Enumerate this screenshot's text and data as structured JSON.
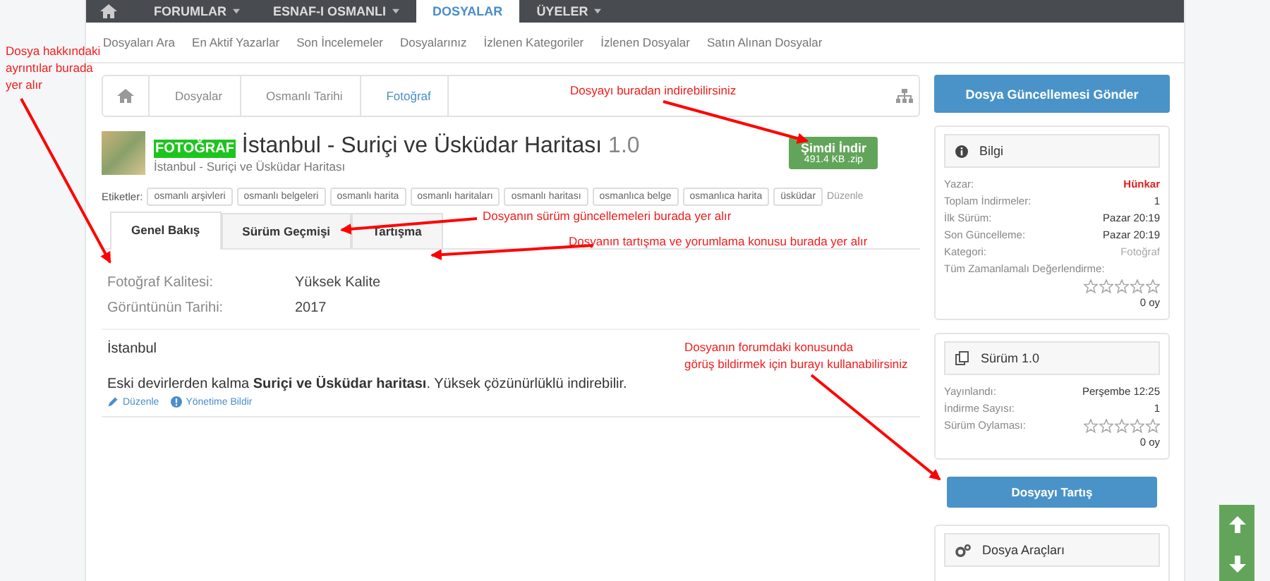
{
  "top_nav": {
    "items": [
      {
        "label": "FORUMLAR",
        "selected": false,
        "has_menu": true
      },
      {
        "label": "ESNAF-I OSMANLI",
        "selected": false,
        "has_menu": true
      },
      {
        "label": "DOSYALAR",
        "selected": true,
        "has_menu": false
      },
      {
        "label": "ÜYELER",
        "selected": false,
        "has_menu": true
      }
    ]
  },
  "sub_nav": {
    "items": [
      "Dosyaları Ara",
      "En Aktif Yazarlar",
      "Son İncelemeler",
      "Dosyalarınız",
      "İzlenen Kategoriler",
      "İzlenen Dosyalar",
      "Satın Alınan Dosyalar"
    ]
  },
  "breadcrumb": [
    {
      "label": "Dosyalar",
      "selected": false
    },
    {
      "label": "Osmanlı Tarihi",
      "selected": false
    },
    {
      "label": "Fotoğraf",
      "selected": true
    }
  ],
  "submit_button": "Dosya Güncellemesi Gönder",
  "resource": {
    "badge": "FOTOĞRAF",
    "title": "İstanbul - Suriçi ve Üsküdar Haritası",
    "version": "1.0",
    "subtitle": "İstanbul - Suriçi ve Üsküdar Haritası",
    "download": {
      "label": "Şimdi İndir",
      "size": "491.4 KB .zip"
    },
    "tags_label": "Etiketler:",
    "tags": [
      "osmanlı arşivleri",
      "osmanlı belgeleri",
      "osmanlı harita",
      "osmanlı haritaları",
      "osmanlı haritası",
      "osmanlıca belge",
      "osmanlıca harita",
      "üsküdar"
    ],
    "tags_edit": "Düzenle"
  },
  "tabs": [
    {
      "label": "Genel Bakış",
      "selected": true
    },
    {
      "label": "Sürüm Geçmişi",
      "selected": false
    },
    {
      "label": "Tartışma",
      "selected": false
    }
  ],
  "fields": [
    {
      "label": "Fotoğraf Kalitesi:",
      "value": "Yüksek Kalite"
    },
    {
      "label": "Görüntünün Tarihi:",
      "value": "2017"
    }
  ],
  "description": {
    "heading": "İstanbul",
    "text": "Eski devirlerden kalma **Suriçi ve Üsküdar haritası**. Yüksek çözünürlüklü indirebilir.",
    "edit": "Düzenle",
    "report": "Yönetime Bildir"
  },
  "info_box": {
    "title": "Bilgi",
    "rows": [
      {
        "label": "Yazar:",
        "value": "Hünkar",
        "kind": "user"
      },
      {
        "label": "Toplam İndirmeler:",
        "value": "1",
        "kind": "plain"
      },
      {
        "label": "İlk Sürüm:",
        "value": "Pazar 20:19",
        "kind": "plain"
      },
      {
        "label": "Son Güncelleme:",
        "value": "Pazar 20:19",
        "kind": "plain"
      },
      {
        "label": "Kategori:",
        "value": "Fotoğraf",
        "kind": "muted"
      }
    ],
    "rating_label": "Tüm Zamanlamalı Değerlendirme:",
    "stars": 0,
    "votes": "0 oy"
  },
  "version_box": {
    "title": "Sürüm 1.0",
    "rows": [
      {
        "label": "Yayınlandı:",
        "value": "Perşembe 12:25"
      },
      {
        "label": "İndirme Sayısı:",
        "value": "1"
      }
    ],
    "rating_label": "Sürüm Oylaması:",
    "stars": 0,
    "votes": "0 oy"
  },
  "discuss_button": "Dosyayı Tartış",
  "tools_box": {
    "title": "Dosya Araçları"
  },
  "annotations": [
    {
      "lines": [
        "Dosya hakkındaki",
        "ayrıntılar burada",
        "yer alır"
      ]
    },
    {
      "lines": [
        "Dosyayı buradan indirebilirsiniz"
      ]
    },
    {
      "lines": [
        "Dosyanın sürüm güncellemeleri burada yer alır"
      ]
    },
    {
      "lines": [
        "Dosyanın tartışma ve yorumlama konusu burada yer alır"
      ]
    },
    {
      "lines": [
        "Dosyanın forumdaki konusunda",
        "görüş bildirmek için burayı kullanabilirsiniz"
      ]
    }
  ]
}
